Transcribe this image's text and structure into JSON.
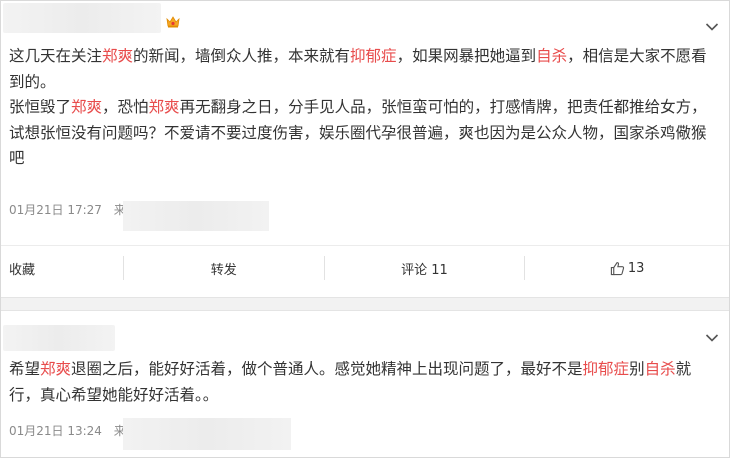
{
  "post1": {
    "content": [
      [
        {
          "t": "这几天在关注"
        },
        {
          "t": "郑爽",
          "hl": true
        },
        {
          "t": "的新闻，墙倒众人推，本来就有"
        },
        {
          "t": "抑郁症",
          "hl": true
        },
        {
          "t": "，如果网暴把她逼到"
        },
        {
          "t": "自杀",
          "hl": true
        },
        {
          "t": "，相信是大家不愿看到的。"
        }
      ],
      [
        {
          "t": "张恒毁了"
        },
        {
          "t": "郑爽",
          "hl": true
        },
        {
          "t": "，恐怕"
        },
        {
          "t": "郑爽",
          "hl": true
        },
        {
          "t": "再无翻身之日，分手见人品，张恒蛮可怕的，打感情牌，把责任都推给女方，试想张恒没有问题吗？不爱请不要过度伤害，娱乐圈代孕很普遍，爽也因为是公众人物，国家杀鸡儆猴吧"
        }
      ]
    ],
    "time": "01月21日 17:27",
    "meta_extra": "来",
    "actions": {
      "collect": "收藏",
      "repost": "转发",
      "comment": "评论 11",
      "like": "13"
    }
  },
  "post2": {
    "content": [
      [
        {
          "t": "希望"
        },
        {
          "t": "郑爽",
          "hl": true
        },
        {
          "t": "退圈之后，能好好活着，做个普通人。感觉她精神上出现问题了，最好不是"
        },
        {
          "t": "抑郁症",
          "hl": true
        },
        {
          "t": "别"
        },
        {
          "t": "自杀",
          "hl": true
        },
        {
          "t": "就行，真心希望她能好好活着。。"
        }
      ]
    ],
    "time": "01月21日 13:24",
    "meta_extra": "来"
  },
  "colors": {
    "highlight": "#e84c4c",
    "text": "#333333",
    "meta": "#8a8a8a",
    "crown": "#f5a623"
  },
  "icons": {
    "crown": "crown-icon",
    "chevron": "chevron-down-icon",
    "thumb": "thumb-up-icon"
  }
}
